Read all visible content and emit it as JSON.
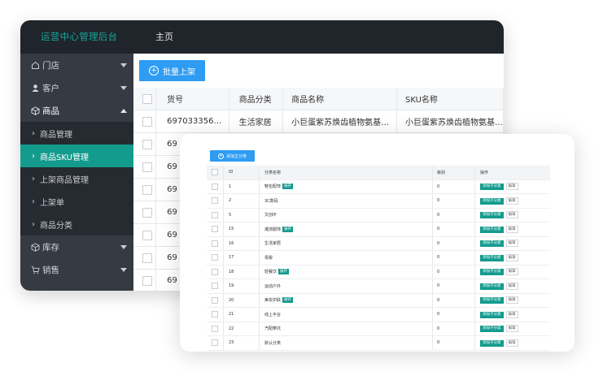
{
  "app": {
    "brand": "运营中心管理后台",
    "nav_home": "主页"
  },
  "sidebar": {
    "items": [
      {
        "label": "门店",
        "icon": "store-icon",
        "expanded": false
      },
      {
        "label": "客户",
        "icon": "user-icon",
        "expanded": false
      },
      {
        "label": "商品",
        "icon": "box-icon",
        "expanded": true
      },
      {
        "label": "库存",
        "icon": "inventory-icon",
        "expanded": false
      },
      {
        "label": "销售",
        "icon": "cart-icon",
        "expanded": false
      }
    ],
    "subitems": [
      {
        "label": "商品管理",
        "active": false
      },
      {
        "label": "商品SKU管理",
        "active": true
      },
      {
        "label": "上架商品管理",
        "active": false
      },
      {
        "label": "上架单",
        "active": false
      },
      {
        "label": "商品分类",
        "active": false
      }
    ]
  },
  "back_table": {
    "batch_button": "批量上架",
    "headers": [
      "货号",
      "商品分类",
      "商品名称",
      "SKU名称"
    ],
    "rows": [
      [
        "697033356…",
        "生活家居",
        "小巨蛋紫苏焕齿植物氨基…",
        "小巨蛋紫苏焕齿植物氨基…"
      ],
      [
        "69",
        "",
        "",
        ""
      ],
      [
        "69",
        "",
        "",
        ""
      ],
      [
        "69",
        "",
        "",
        ""
      ],
      [
        "69",
        "",
        "",
        ""
      ],
      [
        "69",
        "",
        "",
        ""
      ],
      [
        "69",
        "",
        "",
        ""
      ],
      [
        "69",
        "",
        "",
        ""
      ]
    ]
  },
  "front_table": {
    "add_root_button": "添加主分类",
    "headers": [
      "ID",
      "分类名称",
      "级别",
      "操作"
    ],
    "add_child_label": "添加子分类",
    "edit_label": "编辑",
    "expand_label": "展开",
    "rows": [
      {
        "id": "1",
        "name": "鞋包配饰",
        "level": "0",
        "expand": true
      },
      {
        "id": "2",
        "name": "3C数码",
        "level": "0",
        "expand": false
      },
      {
        "id": "5",
        "name": "文创IP",
        "level": "0",
        "expand": false
      },
      {
        "id": "15",
        "name": "潮流服饰",
        "level": "0",
        "expand": true
      },
      {
        "id": "16",
        "name": "生活家居",
        "level": "0",
        "expand": false
      },
      {
        "id": "17",
        "name": "母婴",
        "level": "0",
        "expand": false
      },
      {
        "id": "18",
        "name": "轻餐饮",
        "level": "0",
        "expand": true
      },
      {
        "id": "19",
        "name": "运动户外",
        "level": "0",
        "expand": false
      },
      {
        "id": "20",
        "name": "美妆护肤",
        "level": "0",
        "expand": true
      },
      {
        "id": "21",
        "name": "线上平台",
        "level": "0",
        "expand": false
      },
      {
        "id": "22",
        "name": "汽配摩托",
        "level": "0",
        "expand": false
      },
      {
        "id": "23",
        "name": "默认分类",
        "level": "0",
        "expand": false
      }
    ]
  },
  "colors": {
    "accent": "#139b8d",
    "primary_button": "#2e9cf3",
    "topbar": "#20242b",
    "sidebar": "#363a42"
  }
}
